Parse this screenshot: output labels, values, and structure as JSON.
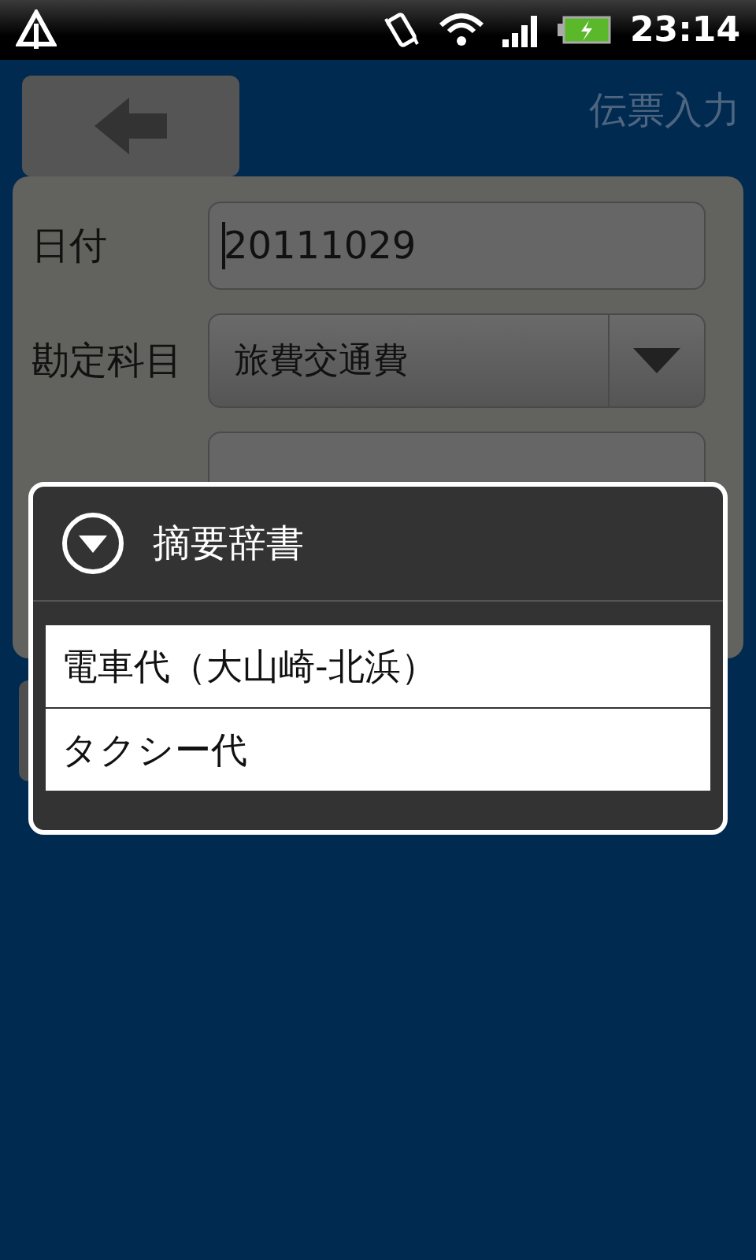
{
  "status_bar": {
    "time": "23:14"
  },
  "header": {
    "title": "伝票入力"
  },
  "form": {
    "fields": [
      {
        "kind": "text",
        "label": "日付",
        "value": "20111029",
        "focused": true
      },
      {
        "kind": "select",
        "label": "勘定科目",
        "value": "旅費交通費"
      },
      {
        "kind": "hidden"
      }
    ]
  },
  "dialog": {
    "title": "摘要辞書",
    "items": [
      {
        "label": "電車代（大山崎-北浜）"
      },
      {
        "label": "タクシー代"
      }
    ]
  }
}
